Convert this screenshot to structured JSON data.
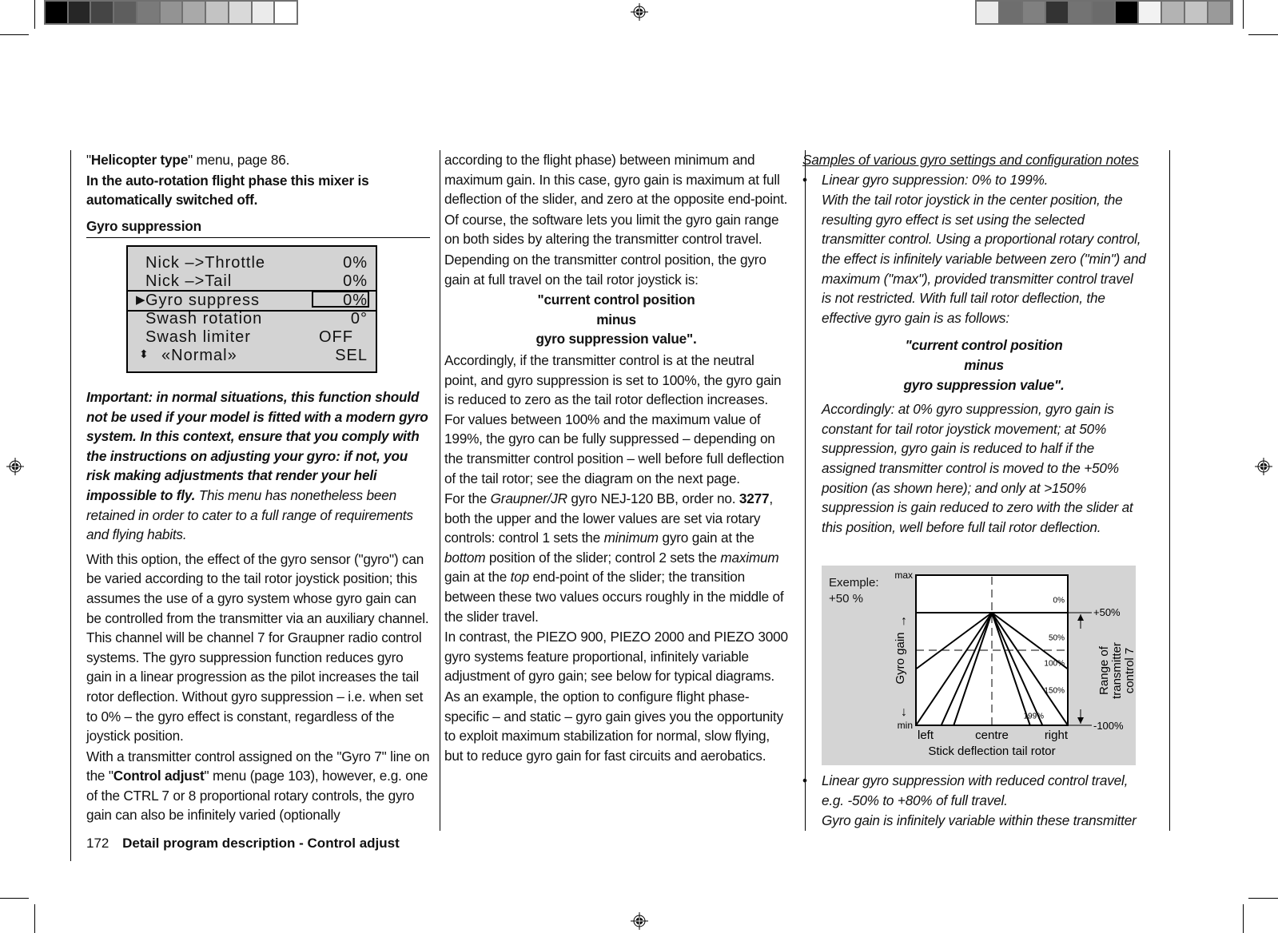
{
  "print_marks": {
    "left_color_bar": [
      "#000000",
      "#262626",
      "#454545",
      "#5e5e5e",
      "#7a7a7a",
      "#939393",
      "#a9a9a9",
      "#c3c3c3",
      "#d9d9d9",
      "#ebebeb",
      "#ffffff"
    ],
    "right_color_bar": [
      "#ebebeb",
      "#6e6e6e",
      "#808080",
      "#333333",
      "#737373",
      "#6b6b6b",
      "#000000",
      "#f2f2f2",
      "#b3b3b3",
      "#c4c4c4",
      "#9a9a9a"
    ]
  },
  "left_column": {
    "intro_quote": "\"",
    "intro_bold": "Helicopter type",
    "intro_rest": "\" menu, page 86.",
    "autorotation_note": "In the auto-rotation flight phase this mixer is automatically switched off.",
    "section_title": "Gyro suppression",
    "lcd": {
      "rows": [
        {
          "label": "Nick  –>Throttle",
          "value": "0%"
        },
        {
          "label": "Nick  –>Tail",
          "value": "0%"
        },
        {
          "label": "Gyro suppress",
          "value": "0%",
          "selected": true
        },
        {
          "label": "Swash rotation",
          "value": "0°"
        },
        {
          "label": "Swash limiter",
          "value": "OFF"
        },
        {
          "label": "«Normal»",
          "value": "SEL"
        }
      ]
    },
    "important_bold": "Important: in normal situations, this function should not be used if your model is fitted with a modern gyro system. In this context, ensure that you comply with the instructions on adjusting your gyro: if not, you risk making adjustments that render your heli impossible to fly.",
    "important_italic": " This menu has nonetheless been retained in order to cater to a full range of requirements and flying habits.",
    "para1": "With this option, the effect of the gyro sensor (\"gyro\") can be varied according to the tail rotor joystick position; this assumes the use of a gyro system whose gyro gain can be controlled from the transmitter via an auxiliary channel. This channel will be channel 7 for  Graupner radio control systems.  The gyro suppression function reduces gyro gain in a linear progression as the pilot increases the tail rotor deflection. Without gyro suppression –  i.e. when set to 0%  –  the gyro effect is constant, regardless of the joystick position.",
    "para2_pre": "With a transmitter control assigned on the \"Gyro 7\" line on the \"",
    "para2_bold": "Control adjust",
    "para2_post": "\" menu (page 103), however, e.g. one of the CTRL 7 or 8 proportional rotary controls, the gyro gain can also be infinitely varied (optionally"
  },
  "middle_column": {
    "para1": "according to the flight phase) between minimum and maximum gain. In this case, gyro gain is maximum at full deflection of the slider, and zero at the opposite end-point.",
    "para2": "Of course, the software lets you limit the gyro gain range on both sides by altering the transmitter control travel.",
    "para3": "Depending on the transmitter control position, the gyro gain at full travel on the tail rotor joystick is:",
    "formula": [
      "\"current control position",
      "minus",
      "gyro suppression value\"."
    ],
    "para4": "Accordingly, if the transmitter control is at the neutral point, and gyro suppression is set to 100%, the gyro gain is reduced to zero as the tail rotor deflection increases. For values between 100% and the maximum value of 199%, the gyro can be fully suppressed  –  depending on the transmitter control position  –  well before full deflection of the tail rotor; see the diagram on the next page.",
    "para5_a": "For the ",
    "para5_i1": "Graupner/JR",
    "para5_b": " gyro NEJ-120 BB, order no. ",
    "para5_bold": "3277",
    "para5_c": ", both the upper and the lower values are set via rotary controls: control 1 sets the ",
    "para5_i2": "minimum",
    "para5_d": " gyro gain at the ",
    "para5_i3": "bottom",
    "para5_e": " position of the slider; control 2 sets the ",
    "para5_i4": "maximum",
    "para5_f": " gain at the ",
    "para5_i5": "top",
    "para5_g": " end-point of the slider; the transition between these two values occurs roughly in the middle of the slider travel.",
    "para6": "In contrast, the PIEZO 900, PIEZO 2000 and PIEZO 3000 gyro systems feature proportional, infinitely variable adjustment of gyro gain; see below for typical diagrams.",
    "para7": "As an example, the option to configure flight phase-specific – and static – gyro gain gives you the opportunity to exploit maximum stabilization for normal, slow flying, but to reduce gyro gain for fast circuits and aerobatics."
  },
  "right_column": {
    "heading": "Samples of various gyro settings and configuration notes",
    "bullet1_title": "Linear gyro suppression: 0% to 199%.",
    "bullet1_text": "With the tail rotor joystick in the center position, the resulting gyro effect is set using the selected transmitter control. Using a proportional rotary control, the effect is infinitely variable between zero (\"min\") and maximum (\"max\"), provided transmitter control travel is not restricted. With full tail rotor deflection, the effective gyro gain is as follows:",
    "formula": [
      "\"current control position",
      "minus",
      "gyro suppression value\"."
    ],
    "bullet1_text2": "Accordingly: at 0% gyro suppression, gyro gain is constant for tail rotor joystick movement; at 50% suppression, gyro gain is reduced to half if the assigned transmitter control is moved to the +50% position (as shown here); and only at >150% suppression is gain reduced to zero with the slider at this position, well before full tail rotor deflection.",
    "bullet2_title": "Linear gyro suppression with reduced control travel, e.g. -50% to +80% of full travel.",
    "bullet2_text": "Gyro gain is infinitely variable within these transmitter",
    "bullet_glyph": "•"
  },
  "chart_data": {
    "type": "line",
    "title": "Exemple: +50 %",
    "xlabel": "Stick deflection tail rotor",
    "ylabel": "Gyro gain",
    "x_tick_labels": [
      "left",
      "centre",
      "right"
    ],
    "y_tick_labels": [
      "min",
      "max"
    ],
    "right_axis_label": "Range of transmitter control 7",
    "right_axis_ticks": [
      "+50%",
      "-100%"
    ],
    "x_range": [
      -1,
      1
    ],
    "y_range": [
      0,
      1
    ],
    "gain_at_centre": 0.75,
    "series": [
      {
        "name": "0%",
        "suppression": 0
      },
      {
        "name": "50%",
        "suppression": 50
      },
      {
        "name": "100%",
        "suppression": 100
      },
      {
        "name": "150%",
        "suppression": 150
      },
      {
        "name": "199%",
        "suppression": 199
      }
    ],
    "reference_lines": {
      "vertical_dashed_at_x": 0,
      "horizontal_dashed_at_y": 0.5
    }
  },
  "footer": {
    "page_number": "172",
    "title": "Detail program description - Control adjust"
  }
}
